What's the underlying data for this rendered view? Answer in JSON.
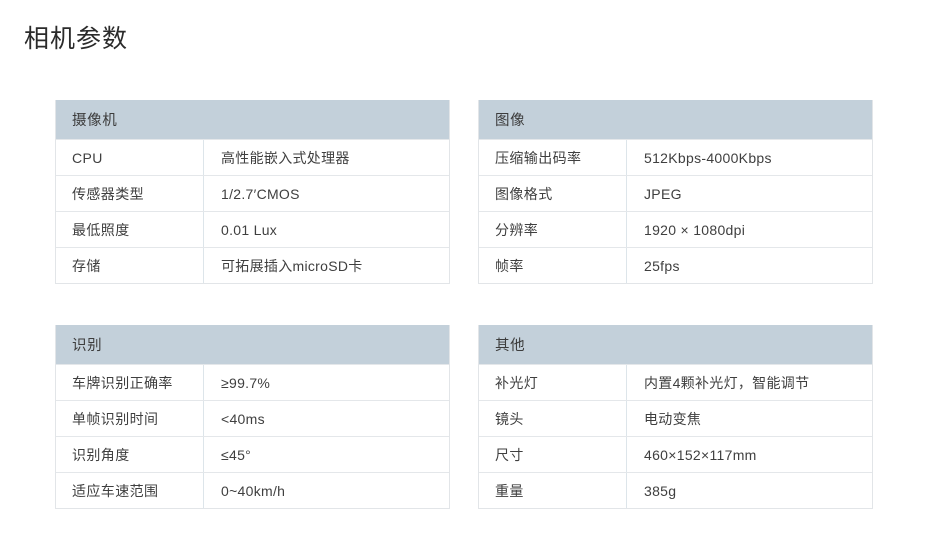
{
  "page": {
    "title": "相机参数",
    "background_color": "#ffffff",
    "header_color": "#c3d0da",
    "border_color": "#e2e5e8",
    "text_color": "#3f3f3f"
  },
  "tables": [
    {
      "header": "摄像机",
      "rows": [
        {
          "label": "CPU",
          "value": "高性能嵌入式处理器"
        },
        {
          "label": "传感器类型",
          "value": "1/2.7′CMOS"
        },
        {
          "label": "最低照度",
          "value": "0.01 Lux"
        },
        {
          "label": "存储",
          "value": "可拓展插入microSD卡"
        }
      ]
    },
    {
      "header": "图像",
      "rows": [
        {
          "label": "压缩输出码率",
          "value": "512Kbps-4000Kbps"
        },
        {
          "label": "图像格式",
          "value": "JPEG"
        },
        {
          "label": "分辨率",
          "value": "1920 × 1080dpi"
        },
        {
          "label": "帧率",
          "value": "25fps"
        }
      ]
    },
    {
      "header": "识别",
      "rows": [
        {
          "label": "车牌识别正确率",
          "value": "≥99.7%"
        },
        {
          "label": "单帧识别时间",
          "value": "<40ms"
        },
        {
          "label": "识别角度",
          "value": "≤45°"
        },
        {
          "label": "适应车速范围",
          "value": "0~40km/h"
        }
      ]
    },
    {
      "header": "其他",
      "rows": [
        {
          "label": "补光灯",
          "value": "内置4颗补光灯，智能调节"
        },
        {
          "label": "镜头",
          "value": "电动变焦"
        },
        {
          "label": "尺寸",
          "value": "460×152×117mm"
        },
        {
          "label": "重量",
          "value": "385g"
        }
      ]
    }
  ]
}
